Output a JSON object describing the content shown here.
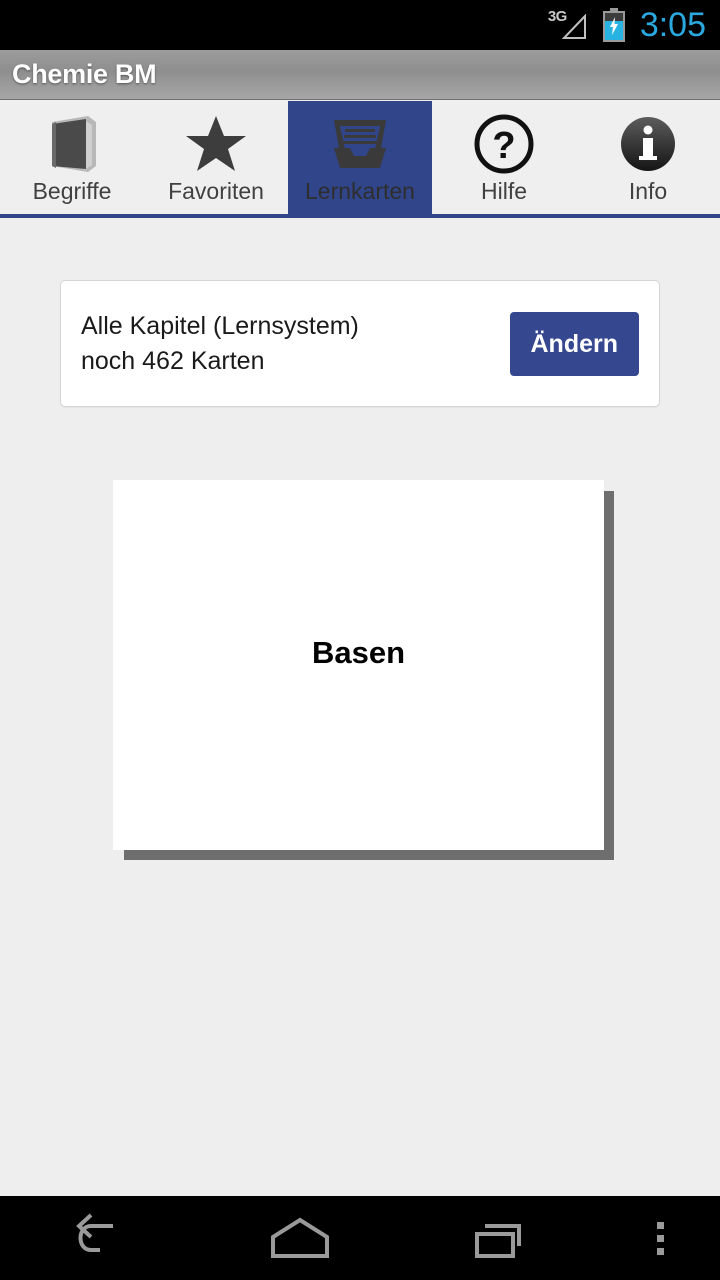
{
  "statusbar": {
    "network_label": "3G",
    "network_icon": "signal-triangle-icon",
    "battery_icon": "battery-charging-icon",
    "clock": "3:05",
    "clock_color": "#2aa9e0"
  },
  "actionbar": {
    "title": "Chemie BM"
  },
  "tabs": {
    "accent_color": "#31458a",
    "items": [
      {
        "label": "Begriffe",
        "icon": "book-icon",
        "active": false
      },
      {
        "label": "Favoriten",
        "icon": "star-icon",
        "active": false
      },
      {
        "label": "Lernkarten",
        "icon": "card-box-icon",
        "active": true
      },
      {
        "label": "Hilfe",
        "icon": "question-mark-circle-icon",
        "active": false
      },
      {
        "label": "Info",
        "icon": "info-circle-icon",
        "active": false
      }
    ]
  },
  "chapter_panel": {
    "line1": "Alle Kapitel (Lernsystem)",
    "line2": "noch 462 Karten",
    "remaining_cards": 462,
    "change_button": "Ändern",
    "button_color": "#35488f"
  },
  "flashcard": {
    "term": "Basen"
  },
  "navbar": {
    "back": "back-icon",
    "home": "home-icon",
    "recents": "recents-icon",
    "overflow": "overflow-menu-icon"
  }
}
